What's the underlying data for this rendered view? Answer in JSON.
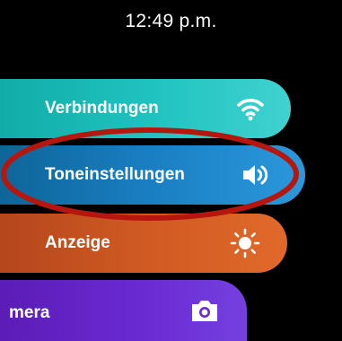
{
  "status": {
    "time": "12:49 p.m."
  },
  "menu": {
    "items": [
      {
        "label": "Verbindungen",
        "icon": "wifi-icon"
      },
      {
        "label": "Toneinstellungen",
        "icon": "speaker-icon"
      },
      {
        "label": "Anzeige",
        "icon": "brightness-icon"
      },
      {
        "label": "mera",
        "icon": "camera-icon"
      }
    ]
  },
  "annotation": {
    "highlight_color": "#b5170e",
    "highlighted_item": "Toneinstellungen"
  },
  "colors": {
    "connections": "#1fc2c0",
    "sound": "#1a7fc2",
    "display": "#d05a22",
    "camera": "#6a2ad2"
  }
}
